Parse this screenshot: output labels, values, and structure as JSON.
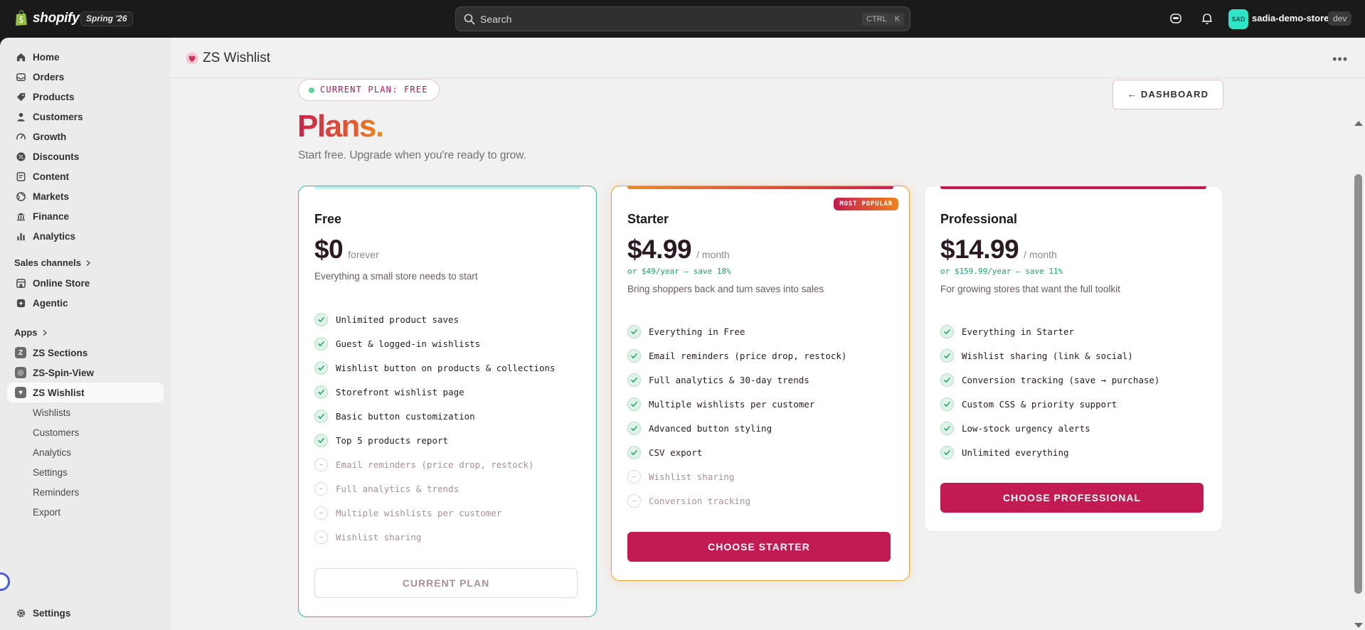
{
  "topbar": {
    "brand": "shopify",
    "edition_badge": "Spring '26",
    "search_placeholder": "Search",
    "shortcut_ctrl": "CTRL",
    "shortcut_key": "K",
    "store_initials": "SAD",
    "store_name": "sadia-demo-store",
    "env_badge": "dev"
  },
  "sidebar": {
    "items": [
      {
        "label": "Home",
        "icon": "home-icon"
      },
      {
        "label": "Orders",
        "icon": "inbox-icon"
      },
      {
        "label": "Products",
        "icon": "tag-icon"
      },
      {
        "label": "Customers",
        "icon": "person-icon"
      },
      {
        "label": "Growth",
        "icon": "gauge-icon"
      },
      {
        "label": "Discounts",
        "icon": "discount-icon"
      },
      {
        "label": "Content",
        "icon": "document-icon"
      },
      {
        "label": "Markets",
        "icon": "globe-icon"
      },
      {
        "label": "Finance",
        "icon": "bank-icon"
      },
      {
        "label": "Analytics",
        "icon": "bar-chart-icon"
      }
    ],
    "sales_channels_label": "Sales channels",
    "channels": [
      {
        "label": "Online Store",
        "icon": "store-icon"
      },
      {
        "label": "Agentic",
        "icon": "sparkle-icon"
      }
    ],
    "apps_label": "Apps",
    "apps": [
      {
        "label": "ZS Sections",
        "icon_text": "Z"
      },
      {
        "label": "ZS-Spin-View",
        "icon_text": "◎"
      },
      {
        "label": "ZS Wishlist",
        "icon_text": "♥"
      }
    ],
    "wishlist_sub": [
      "Wishlists",
      "Customers",
      "Analytics",
      "Settings",
      "Reminders",
      "Export"
    ],
    "settings_label": "Settings"
  },
  "app": {
    "title": "ZS Wishlist"
  },
  "page": {
    "current_plan_pill": "CURRENT PLAN: FREE",
    "dashboard_button": "← DASHBOARD",
    "title": "Plans",
    "title_dot": ".",
    "subtitle": "Start free. Upgrade when you're ready to grow."
  },
  "plans": [
    {
      "name": "Free",
      "price": "$0",
      "period": "forever",
      "annual": "",
      "description": "Everything a small store needs to start",
      "features": [
        {
          "text": "Unlimited product saves",
          "included": true
        },
        {
          "text": "Guest & logged-in wishlists",
          "included": true
        },
        {
          "text": "Wishlist button on products & collections",
          "included": true
        },
        {
          "text": "Storefront wishlist page",
          "included": true
        },
        {
          "text": "Basic button customization",
          "included": true
        },
        {
          "text": "Top 5 products report",
          "included": true
        },
        {
          "text": "Email reminders (price drop, restock)",
          "included": false
        },
        {
          "text": "Full analytics & trends",
          "included": false
        },
        {
          "text": "Multiple wishlists per customer",
          "included": false
        },
        {
          "text": "Wishlist sharing",
          "included": false
        }
      ],
      "button": "CURRENT PLAN"
    },
    {
      "name": "Starter",
      "badge": "MOST POPULAR",
      "price": "$4.99",
      "period": "/ month",
      "annual": "or $49/year — save 18%",
      "description": "Bring shoppers back and turn saves into sales",
      "features": [
        {
          "text": "Everything in Free",
          "included": true
        },
        {
          "text": "Email reminders (price drop, restock)",
          "included": true
        },
        {
          "text": "Full analytics & 30-day trends",
          "included": true
        },
        {
          "text": "Multiple wishlists per customer",
          "included": true
        },
        {
          "text": "Advanced button styling",
          "included": true
        },
        {
          "text": "CSV export",
          "included": true
        },
        {
          "text": "Wishlist sharing",
          "included": false
        },
        {
          "text": "Conversion tracking",
          "included": false
        }
      ],
      "button": "CHOOSE STARTER"
    },
    {
      "name": "Professional",
      "price": "$14.99",
      "period": "/ month",
      "annual": "or $159.99/year — save 11%",
      "description": "For growing stores that want the full toolkit",
      "features": [
        {
          "text": "Everything in Starter",
          "included": true
        },
        {
          "text": "Wishlist sharing (link & social)",
          "included": true
        },
        {
          "text": "Conversion tracking (save → purchase)",
          "included": true
        },
        {
          "text": "Custom CSS & priority support",
          "included": true
        },
        {
          "text": "Low-stock urgency alerts",
          "included": true
        },
        {
          "text": "Unlimited everything",
          "included": true
        }
      ],
      "button": "CHOOSE PROFESSIONAL"
    }
  ],
  "colors": {
    "accent": "#c21a52",
    "brand_gradient_start": "#c7254e",
    "brand_gradient_end": "#f08a1c",
    "included_check": "#1f9e6a",
    "free_card_border": "#3db39a",
    "starter_card_border": "#f0a030"
  }
}
